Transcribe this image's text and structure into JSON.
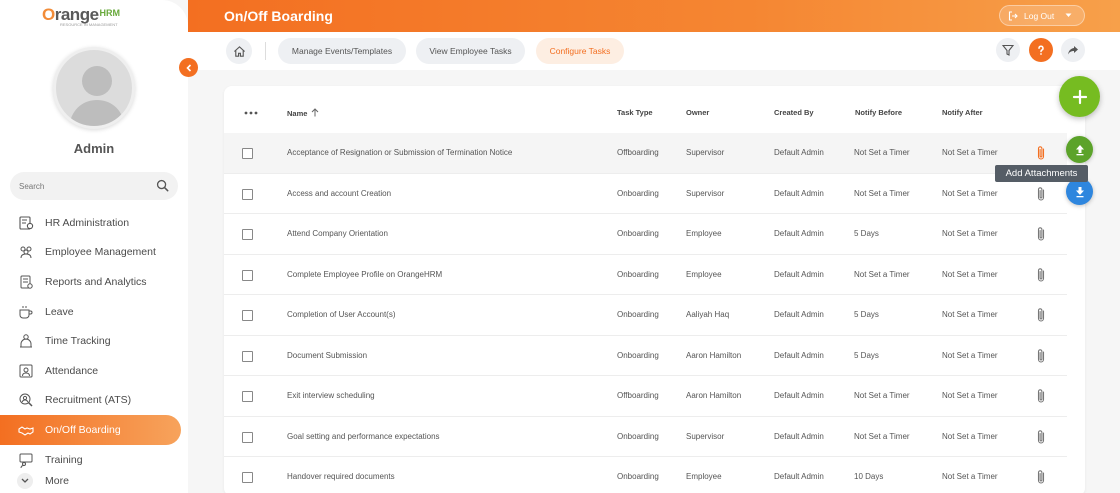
{
  "brand": {
    "logo_main": "range",
    "logo_o": "O",
    "logo_suffix": "HRM",
    "logo_tagline": "RESOURCE IN MANAGEMENT"
  },
  "user": {
    "name": "Admin"
  },
  "search": {
    "placeholder": "Search"
  },
  "nav": {
    "items": [
      {
        "label": "HR Administration",
        "icon": "hr-admin-icon"
      },
      {
        "label": "Employee Management",
        "icon": "employees-icon"
      },
      {
        "label": "Reports and Analytics",
        "icon": "reports-icon"
      },
      {
        "label": "Leave",
        "icon": "leave-icon"
      },
      {
        "label": "Time Tracking",
        "icon": "time-tracking-icon"
      },
      {
        "label": "Attendance",
        "icon": "attendance-icon"
      },
      {
        "label": "Recruitment (ATS)",
        "icon": "recruitment-icon"
      },
      {
        "label": "On/Off Boarding",
        "icon": "handshake-icon",
        "active": true
      },
      {
        "label": "Training",
        "icon": "training-icon"
      }
    ],
    "more_label": "More"
  },
  "header": {
    "title": "On/Off Boarding",
    "logout_label": "Log Out"
  },
  "toolbar": {
    "tabs": [
      {
        "label": "Manage Events/Templates"
      },
      {
        "label": "View Employee Tasks"
      },
      {
        "label": "Configure Tasks",
        "active": true
      }
    ]
  },
  "table": {
    "columns": [
      "Name",
      "Task Type",
      "Owner",
      "Created By",
      "Notify Before",
      "Notify After"
    ],
    "rows": [
      {
        "name": "Acceptance of Resignation or Submission of Termination Notice",
        "type": "Offboarding",
        "owner": "Supervisor",
        "created_by": "Default Admin",
        "before": "Not Set a Timer",
        "after": "Not Set a Timer",
        "highlight": true
      },
      {
        "name": "Access and account Creation",
        "type": "Onboarding",
        "owner": "Supervisor",
        "created_by": "Default Admin",
        "before": "Not Set a Timer",
        "after": "Not Set a Timer"
      },
      {
        "name": "Attend Company Orientation",
        "type": "Onboarding",
        "owner": "Employee",
        "created_by": "Default Admin",
        "before": "5 Days",
        "after": "Not Set a Timer"
      },
      {
        "name": "Complete Employee Profile on OrangeHRM",
        "type": "Onboarding",
        "owner": "Employee",
        "created_by": "Default Admin",
        "before": "Not Set a Timer",
        "after": "Not Set a Timer"
      },
      {
        "name": "Completion of User Account(s)",
        "type": "Onboarding",
        "owner": "Aaliyah Haq",
        "created_by": "Default Admin",
        "before": "5 Days",
        "after": "Not Set a Timer"
      },
      {
        "name": "Document Submission",
        "type": "Onboarding",
        "owner": "Aaron Hamilton",
        "created_by": "Default Admin",
        "before": "5 Days",
        "after": "Not Set a Timer"
      },
      {
        "name": "Exit interview scheduling",
        "type": "Offboarding",
        "owner": "Aaron Hamilton",
        "created_by": "Default Admin",
        "before": "Not Set a Timer",
        "after": "Not Set a Timer"
      },
      {
        "name": "Goal setting and performance expectations",
        "type": "Onboarding",
        "owner": "Supervisor",
        "created_by": "Default Admin",
        "before": "Not Set a Timer",
        "after": "Not Set a Timer"
      },
      {
        "name": "Handover required documents",
        "type": "Onboarding",
        "owner": "Employee",
        "created_by": "Default Admin",
        "before": "10 Days",
        "after": "Not Set a Timer"
      }
    ]
  },
  "tooltip": {
    "text": "Add Attachments"
  },
  "colors": {
    "accent": "#f36f21",
    "green": "#76bc21",
    "blue": "#2e86de"
  }
}
